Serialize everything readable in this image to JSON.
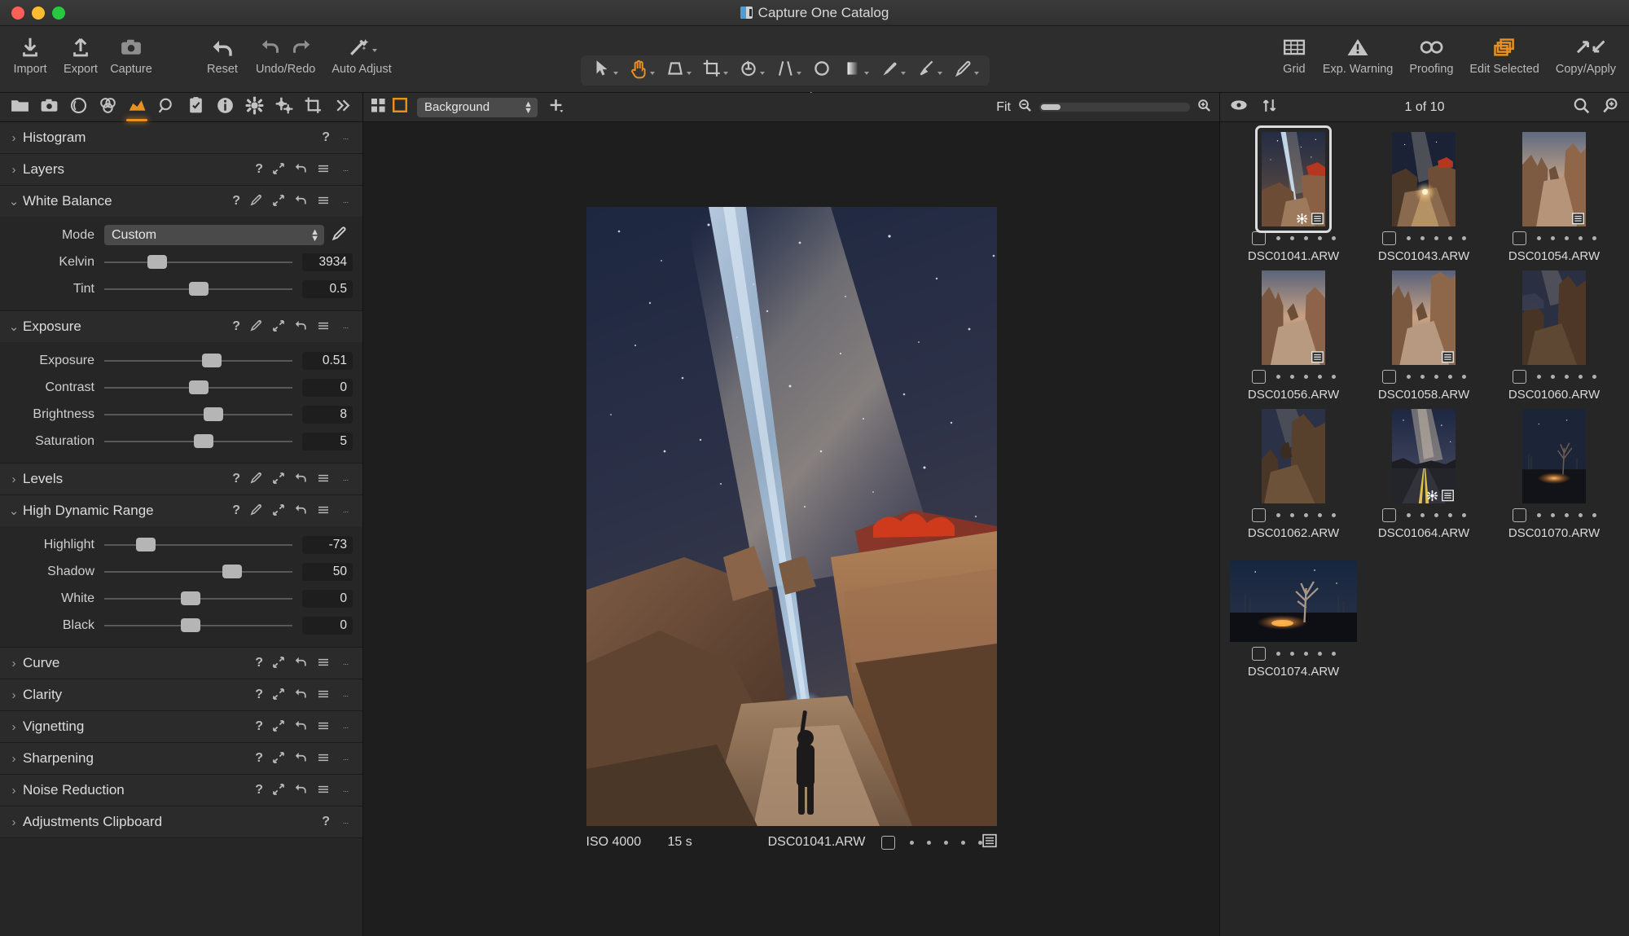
{
  "window": {
    "title": "Capture One Catalog",
    "app_icon": "capture-one-icon"
  },
  "toolbar": {
    "left_buttons": [
      {
        "label": "Import",
        "icon": "import-icon"
      },
      {
        "label": "Export",
        "icon": "export-icon"
      },
      {
        "label": "Capture",
        "icon": "camera-icon"
      }
    ],
    "mid_buttons": [
      {
        "label": "Reset",
        "icon": "reset-arrow-icon"
      },
      {
        "label": "Undo/Redo",
        "icon": "undo-redo-icon"
      },
      {
        "label": "Auto Adjust",
        "icon": "magic-wand-icon"
      }
    ],
    "right_buttons": [
      {
        "label": "Grid",
        "icon": "grid-icon",
        "active": false
      },
      {
        "label": "Exp. Warning",
        "icon": "warning-triangle-icon",
        "active": false
      },
      {
        "label": "Proofing",
        "icon": "glasses-icon",
        "active": false
      },
      {
        "label": "Edit Selected",
        "icon": "stacked-layers-icon",
        "active": true
      },
      {
        "label": "Copy/Apply",
        "icon": "copy-apply-arrows-icon",
        "active": false
      }
    ],
    "cursor_tools": {
      "label": "Cursor Tools",
      "items": [
        {
          "icon": "pointer-icon",
          "active": false,
          "has_caret": true
        },
        {
          "icon": "pan-hand-icon",
          "active": true,
          "has_caret": true
        },
        {
          "icon": "keystone-icon",
          "active": false,
          "has_caret": true
        },
        {
          "icon": "crop-icon",
          "active": false,
          "has_caret": true
        },
        {
          "icon": "rotate-icon",
          "active": false,
          "has_caret": true
        },
        {
          "icon": "straighten-icon",
          "active": false,
          "has_caret": true
        },
        {
          "icon": "spot-removal-icon",
          "active": false,
          "has_caret": false
        },
        {
          "icon": "gradient-mask-icon",
          "active": false,
          "has_caret": true
        },
        {
          "icon": "draw-mask-brush-icon",
          "active": false,
          "has_caret": true
        },
        {
          "icon": "erase-mask-icon",
          "active": false,
          "has_caret": true
        },
        {
          "icon": "heal-brush-icon",
          "active": false,
          "has_caret": true
        }
      ]
    }
  },
  "left_panel": {
    "tool_tabs": [
      {
        "icon": "library-folder-icon",
        "active": false
      },
      {
        "icon": "capture-camera-icon",
        "active": false
      },
      {
        "icon": "lens-correction-icon",
        "active": false
      },
      {
        "icon": "color-wheels-icon",
        "active": false
      },
      {
        "icon": "exposure-curve-icon",
        "active": true
      },
      {
        "icon": "details-loupe-icon",
        "active": false
      },
      {
        "icon": "adjustments-clipboard-icon",
        "active": false
      },
      {
        "icon": "metadata-info-icon",
        "active": false
      },
      {
        "icon": "output-gear-icon",
        "active": false
      },
      {
        "icon": "batch-gears-icon",
        "active": false
      },
      {
        "icon": "crop-tab-icon",
        "active": false
      },
      {
        "icon": "more-chevrons-icon",
        "active": false
      }
    ],
    "tools": [
      {
        "name": "Histogram",
        "expanded": false,
        "header_icons": [
          "help-icon",
          "more-dots-icon"
        ],
        "rows": []
      },
      {
        "name": "Layers",
        "expanded": false,
        "header_icons": [
          "help-icon",
          "expand-icon",
          "reset-icon",
          "menu-icon",
          "more-dots-icon"
        ],
        "rows": []
      },
      {
        "name": "White Balance",
        "expanded": true,
        "header_icons": [
          "help-icon",
          "picker-icon",
          "expand-icon",
          "reset-icon",
          "menu-icon",
          "more-dots-icon"
        ],
        "mode_label": "Mode",
        "mode_value": "Custom",
        "mode_picker_icon": "eyedropper-icon",
        "rows": [
          {
            "label": "Kelvin",
            "value": "3934",
            "pos": 28
          },
          {
            "label": "Tint",
            "value": "0.5",
            "pos": 50
          }
        ]
      },
      {
        "name": "Exposure",
        "expanded": true,
        "header_icons": [
          "help-icon",
          "picker-icon",
          "expand-icon",
          "reset-icon",
          "menu-icon",
          "more-dots-icon"
        ],
        "rows": [
          {
            "label": "Exposure",
            "value": "0.51",
            "pos": 57
          },
          {
            "label": "Contrast",
            "value": "0",
            "pos": 50
          },
          {
            "label": "Brightness",
            "value": "8",
            "pos": 58
          },
          {
            "label": "Saturation",
            "value": "5",
            "pos": 53
          }
        ]
      },
      {
        "name": "Levels",
        "expanded": false,
        "header_icons": [
          "help-icon",
          "picker-icon",
          "expand-icon",
          "reset-icon",
          "menu-icon",
          "more-dots-icon"
        ],
        "rows": []
      },
      {
        "name": "High Dynamic Range",
        "expanded": true,
        "header_icons": [
          "help-icon",
          "picker-icon",
          "expand-icon",
          "reset-icon",
          "menu-icon",
          "more-dots-icon"
        ],
        "rows": [
          {
            "label": "Highlight",
            "value": "-73",
            "pos": 22
          },
          {
            "label": "Shadow",
            "value": "50",
            "pos": 68
          },
          {
            "label": "White",
            "value": "0",
            "pos": 46
          },
          {
            "label": "Black",
            "value": "0",
            "pos": 46
          }
        ]
      },
      {
        "name": "Curve",
        "expanded": false,
        "header_icons": [
          "help-icon",
          "expand-icon",
          "reset-icon",
          "menu-icon",
          "more-dots-icon"
        ],
        "rows": []
      },
      {
        "name": "Clarity",
        "expanded": false,
        "header_icons": [
          "help-icon",
          "expand-icon",
          "reset-icon",
          "menu-icon",
          "more-dots-icon"
        ],
        "rows": []
      },
      {
        "name": "Vignetting",
        "expanded": false,
        "header_icons": [
          "help-icon",
          "expand-icon",
          "reset-icon",
          "menu-icon",
          "more-dots-icon"
        ],
        "rows": []
      },
      {
        "name": "Sharpening",
        "expanded": false,
        "header_icons": [
          "help-icon",
          "expand-icon",
          "reset-icon",
          "menu-icon",
          "more-dots-icon"
        ],
        "rows": []
      },
      {
        "name": "Noise Reduction",
        "expanded": false,
        "header_icons": [
          "help-icon",
          "expand-icon",
          "reset-icon",
          "menu-icon",
          "more-dots-icon"
        ],
        "rows": []
      },
      {
        "name": "Adjustments Clipboard",
        "expanded": false,
        "header_icons": [
          "help-icon",
          "more-dots-icon"
        ],
        "rows": []
      }
    ]
  },
  "viewer": {
    "toolbar": {
      "multi_view_icon": "multi-view-icon",
      "single_view_icon": "single-view-icon",
      "background_select": "Background",
      "add_icon": "add-plus-icon",
      "zoom_label": "Fit",
      "zoom_out_icon": "zoom-out-icon",
      "zoom_in_icon": "zoom-in-icon",
      "zoom_slider_pct": 13
    },
    "image_info": {
      "iso": "ISO 4000",
      "shutter": "15 s",
      "filename": "DSC01041.ARW",
      "checkbox_checked": false,
      "rating_dots": 5,
      "badge_icon": "metadata-badge-icon"
    }
  },
  "browser": {
    "toolbar": {
      "visibility_icon": "eye-icon",
      "sort_icon": "sort-updown-icon",
      "count_label": "1 of 10",
      "search_icon": "search-icon",
      "zoom_thumbs_icon": "thumb-zoom-icon"
    },
    "thumbnails": [
      {
        "name": "DSC01041.ARW",
        "selected": true,
        "orientation": "portrait",
        "scene": "milky-way-light-beam",
        "badges": [
          "settings-gear-badge",
          "metadata-badge"
        ]
      },
      {
        "name": "DSC01043.ARW",
        "selected": false,
        "orientation": "portrait",
        "scene": "canyon-headlamp-trail",
        "badges": []
      },
      {
        "name": "DSC01054.ARW",
        "selected": false,
        "orientation": "portrait",
        "scene": "hoodoos-dusk",
        "badges": [
          "metadata-badge"
        ]
      },
      {
        "name": "DSC01056.ARW",
        "selected": false,
        "orientation": "portrait",
        "scene": "hoodoo-trail-dusk",
        "badges": [
          "metadata-badge"
        ]
      },
      {
        "name": "DSC01058.ARW",
        "selected": false,
        "orientation": "portrait",
        "scene": "hoodoo-arch-dusk",
        "badges": [
          "metadata-badge"
        ]
      },
      {
        "name": "DSC01060.ARW",
        "selected": false,
        "orientation": "portrait",
        "scene": "dark-hoodoo-night",
        "badges": []
      },
      {
        "name": "DSC01062.ARW",
        "selected": false,
        "orientation": "portrait",
        "scene": "canyon-wall-night",
        "badges": []
      },
      {
        "name": "DSC01064.ARW",
        "selected": false,
        "orientation": "portrait",
        "scene": "milky-way-highway",
        "badges": [
          "settings-gear-badge",
          "metadata-badge"
        ]
      },
      {
        "name": "DSC01070.ARW",
        "selected": false,
        "orientation": "portrait",
        "scene": "bare-tree-glow",
        "badges": []
      },
      {
        "name": "DSC01074.ARW",
        "selected": false,
        "orientation": "landscape",
        "scene": "bare-tree-campfire",
        "badges": []
      }
    ]
  },
  "colors": {
    "accent": "#e8911f",
    "panel_bg": "#262626",
    "header_bg": "#2b2b2b",
    "toolbar_bg": "#2d2d2d",
    "viewer_bg": "#1e1e1e",
    "text": "#dcdcdc"
  }
}
